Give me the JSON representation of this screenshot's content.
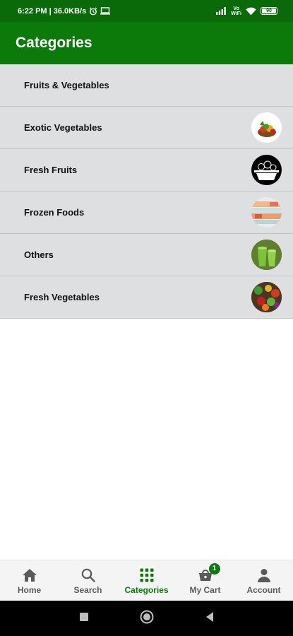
{
  "status_bar": {
    "time_speed": "6:22 PM | 36.0KB/s",
    "volte": "Vo\nWiFi",
    "battery": "90"
  },
  "app_bar": {
    "title": "Categories"
  },
  "categories": [
    {
      "label": "Fruits & Vegetables",
      "thumb": "none"
    },
    {
      "label": "Exotic Vegetables",
      "thumb": "vegetable-basket-image"
    },
    {
      "label": "Fresh Fruits",
      "thumb": "fruit-basket-icon"
    },
    {
      "label": "Frozen Foods",
      "thumb": "frozen-food-image"
    },
    {
      "label": "Others",
      "thumb": "green-juice-image"
    },
    {
      "label": "Fresh Vegetables",
      "thumb": "vegetables-image"
    }
  ],
  "bottom_nav": {
    "home": "Home",
    "search": "Search",
    "categories": "Categories",
    "cart": "My Cart",
    "cart_count": "1",
    "account": "Account"
  },
  "colors": {
    "primary": "#0b7a0b",
    "row_bg": "#dedfe1"
  }
}
